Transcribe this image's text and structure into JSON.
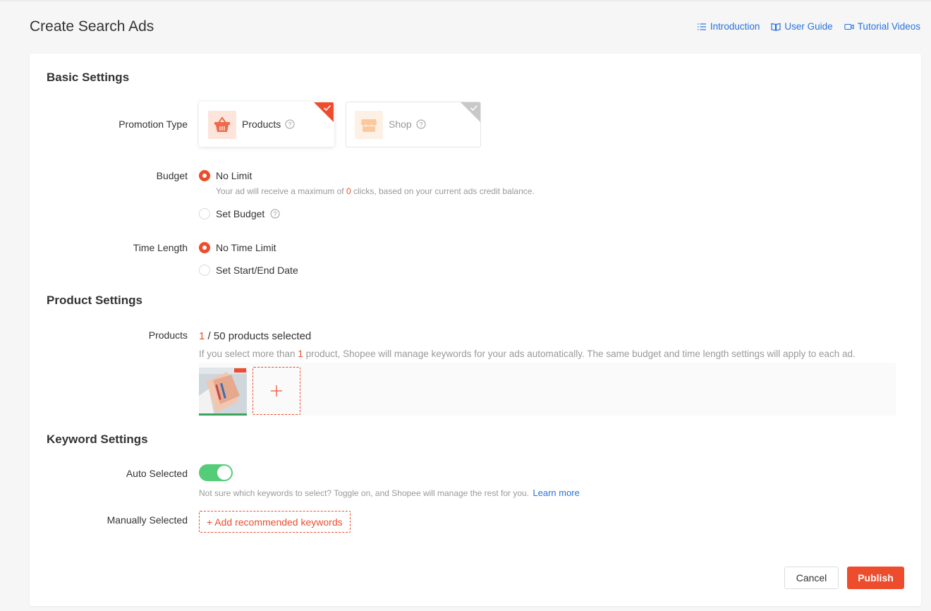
{
  "page": {
    "title": "Create Search Ads",
    "links": {
      "introduction": "Introduction",
      "user_guide": "User Guide",
      "tutorial_videos": "Tutorial Videos"
    }
  },
  "basic_settings": {
    "title": "Basic Settings",
    "promotion_type": {
      "label": "Promotion Type",
      "options": [
        {
          "label": "Products",
          "selected": true
        },
        {
          "label": "Shop",
          "selected": false
        }
      ]
    },
    "budget": {
      "label": "Budget",
      "no_limit": "No Limit",
      "hint_prefix": "Your ad will receive a maximum of ",
      "hint_clicks": "0",
      "hint_suffix": " clicks, based on your current ads credit balance.",
      "set_budget": "Set Budget",
      "selected": "No Limit"
    },
    "time_length": {
      "label": "Time Length",
      "no_time_limit": "No Time Limit",
      "set_dates": "Set Start/End Date",
      "selected": "No Time Limit"
    }
  },
  "product_settings": {
    "title": "Product Settings",
    "products_label": "Products",
    "selected_count": "1",
    "selected_suffix": " / 50 products selected",
    "hint_prefix": "If you select more than ",
    "hint_count": "1",
    "hint_suffix": " product, Shopee will manage keywords for your ads automatically. The same budget and time length settings will apply to each ad."
  },
  "keyword_settings": {
    "title": "Keyword Settings",
    "auto_label": "Auto Selected",
    "auto_enabled": true,
    "auto_hint": "Not sure which keywords to select? Toggle on, and Shopee will manage the rest for you.",
    "learn_more": "Learn more",
    "manual_label": "Manually Selected",
    "add_keywords": "+ Add recommended keywords"
  },
  "actions": {
    "cancel": "Cancel",
    "publish": "Publish"
  },
  "colors": {
    "accent": "#ee4d2d",
    "link": "#2673dd",
    "toggle_on": "#55cc77"
  }
}
